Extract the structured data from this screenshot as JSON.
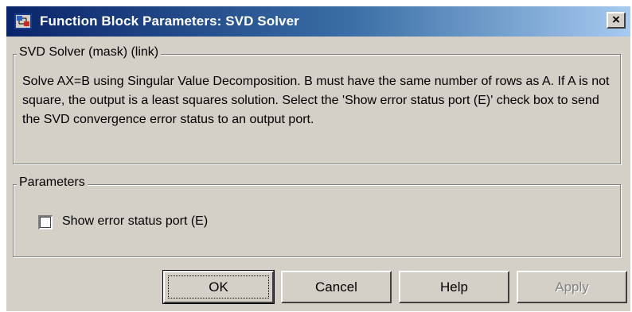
{
  "window": {
    "title": "Function Block Parameters: SVD Solver",
    "close_glyph": "×",
    "icon": "simulink-block-icon"
  },
  "description_group": {
    "legend": "SVD Solver (mask) (link)",
    "text": "Solve AX=B using Singular Value Decomposition.  B must have the same number of rows as A.  If A is not square, the output is a least squares solution. Select the 'Show error status port (E)' check box to send the SVD convergence error status to an output port."
  },
  "parameters_group": {
    "legend": "Parameters",
    "show_error_status_port": {
      "label": "Show error status port (E)",
      "checked": false
    }
  },
  "buttons": {
    "ok": "OK",
    "cancel": "Cancel",
    "help": "Help",
    "apply": "Apply"
  },
  "colors": {
    "title_gradient_start": "#0a246a",
    "title_gradient_end": "#a6caf0",
    "face": "#d4d0c8",
    "disabled_text": "#808080"
  }
}
